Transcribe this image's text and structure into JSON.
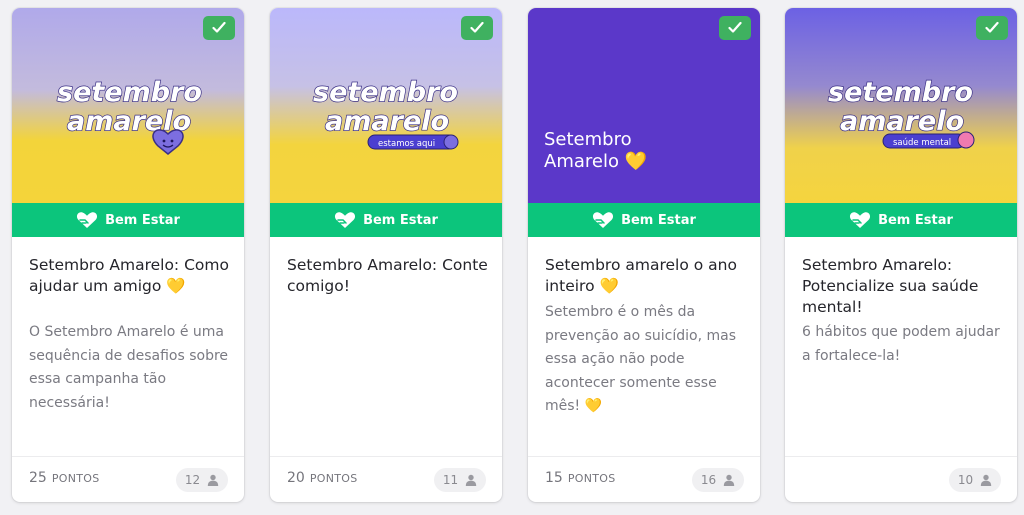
{
  "colors": {
    "category_green": "#0cc57c",
    "check_green": "#3fb160",
    "card_text": "#25252b",
    "muted_text": "#7a7a82",
    "purple_banner": "#5b38c9"
  },
  "cards": [
    {
      "completed": true,
      "art": {
        "line1": "setembro",
        "line2": "amarelo",
        "badge": ""
      },
      "category": "Bem Estar",
      "title": "Setembro Amarelo: Como ajudar um amigo 💛",
      "description": "O Setembro Amarelo é uma sequência de desafios sobre essa campanha tão necessária!",
      "points_value": "25",
      "points_unit": "PONTOS",
      "participants": "12"
    },
    {
      "completed": true,
      "art": {
        "line1": "setembro",
        "line2": "amarelo",
        "badge": "estamos aqui"
      },
      "category": "Bem Estar",
      "title": "Setembro Amarelo: Conte comigo!",
      "description": "",
      "points_value": "20",
      "points_unit": "PONTOS",
      "participants": "11"
    },
    {
      "completed": true,
      "art": {
        "line1": "Setembro",
        "line2": "Amarelo 💛",
        "badge": ""
      },
      "category": "Bem Estar",
      "title": "Setembro amarelo o ano inteiro 💛",
      "description": "Setembro é o mês da prevenção ao suicídio, mas essa ação não pode acontecer somente esse mês! 💛",
      "points_value": "15",
      "points_unit": "PONTOS",
      "participants": "16"
    },
    {
      "completed": true,
      "art": {
        "line1": "setembro",
        "line2": "amarelo",
        "badge": "saúde mental"
      },
      "category": "Bem Estar",
      "title": "Setembro Amarelo: Potencialize sua saúde mental!",
      "description": "6 hábitos que podem ajudar a fortalece-la!",
      "points_value": "",
      "points_unit": "",
      "participants": "10"
    }
  ],
  "icons": {
    "check": "check-icon",
    "category": "heart-hand-icon",
    "participants": "person-icon"
  }
}
